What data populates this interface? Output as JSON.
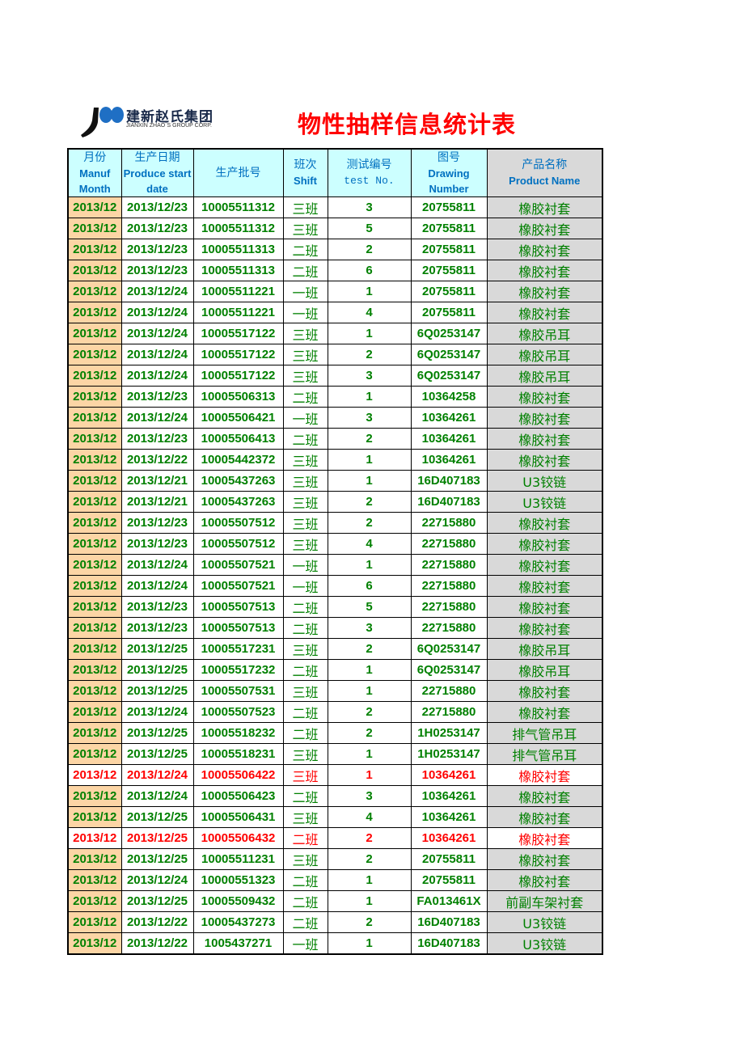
{
  "logo": {
    "name_cn": "建新赵氏集团",
    "name_en": "JIANXIN ZHAO`S GROUP CORP.",
    "icon": "jianxin-logo-mark"
  },
  "title": "物性抽样信息统计表",
  "colors": {
    "header_bg": "#ccffff",
    "header_text": "#0070c0",
    "month_bg": "#fcd5a5",
    "product_bg": "#d9d9d9",
    "normal_text": "#008000",
    "flagged_text": "#ff0000",
    "title": "#ff0000"
  },
  "headers": {
    "month": {
      "cn": "月份",
      "en1": "Manuf",
      "en2": "Month"
    },
    "date": {
      "cn": "生产日期",
      "en1": "Produce start",
      "en2": "date"
    },
    "batch": {
      "cn": "生产批号"
    },
    "shift": {
      "cn": "班次",
      "en1": "Shift"
    },
    "test": {
      "cn": "测试编号",
      "en1": "test No."
    },
    "drawing": {
      "cn": "图号",
      "en1": "Drawing",
      "en2": "Number"
    },
    "product": {
      "cn": "产品名称",
      "en1": "Product Name"
    }
  },
  "rows": [
    {
      "month": "2013/12",
      "date": "2013/12/23",
      "batch": "10005511312",
      "shift": "三班",
      "test": "3",
      "drawing": "20755811",
      "product": "橡胶衬套",
      "flagged": false
    },
    {
      "month": "2013/12",
      "date": "2013/12/23",
      "batch": "10005511312",
      "shift": "三班",
      "test": "5",
      "drawing": "20755811",
      "product": "橡胶衬套",
      "flagged": false
    },
    {
      "month": "2013/12",
      "date": "2013/12/23",
      "batch": "10005511313",
      "shift": "二班",
      "test": "2",
      "drawing": "20755811",
      "product": "橡胶衬套",
      "flagged": false
    },
    {
      "month": "2013/12",
      "date": "2013/12/23",
      "batch": "10005511313",
      "shift": "二班",
      "test": "6",
      "drawing": "20755811",
      "product": "橡胶衬套",
      "flagged": false
    },
    {
      "month": "2013/12",
      "date": "2013/12/24",
      "batch": "10005511221",
      "shift": "一班",
      "test": "1",
      "drawing": "20755811",
      "product": "橡胶衬套",
      "flagged": false
    },
    {
      "month": "2013/12",
      "date": "2013/12/24",
      "batch": "10005511221",
      "shift": "一班",
      "test": "4",
      "drawing": "20755811",
      "product": "橡胶衬套",
      "flagged": false
    },
    {
      "month": "2013/12",
      "date": "2013/12/24",
      "batch": "10005517122",
      "shift": "三班",
      "test": "1",
      "drawing": "6Q0253147",
      "product": "橡胶吊耳",
      "flagged": false
    },
    {
      "month": "2013/12",
      "date": "2013/12/24",
      "batch": "10005517122",
      "shift": "三班",
      "test": "2",
      "drawing": "6Q0253147",
      "product": "橡胶吊耳",
      "flagged": false
    },
    {
      "month": "2013/12",
      "date": "2013/12/24",
      "batch": "10005517122",
      "shift": "三班",
      "test": "3",
      "drawing": "6Q0253147",
      "product": "橡胶吊耳",
      "flagged": false
    },
    {
      "month": "2013/12",
      "date": "2013/12/23",
      "batch": "10005506313",
      "shift": "二班",
      "test": "1",
      "drawing": "10364258",
      "product": "橡胶衬套",
      "flagged": false
    },
    {
      "month": "2013/12",
      "date": "2013/12/24",
      "batch": "10005506421",
      "shift": "一班",
      "test": "3",
      "drawing": "10364261",
      "product": "橡胶衬套",
      "flagged": false
    },
    {
      "month": "2013/12",
      "date": "2013/12/23",
      "batch": "10005506413",
      "shift": "二班",
      "test": "2",
      "drawing": "10364261",
      "product": "橡胶衬套",
      "flagged": false
    },
    {
      "month": "2013/12",
      "date": "2013/12/22",
      "batch": "10005442372",
      "shift": "三班",
      "test": "1",
      "drawing": "10364261",
      "product": "橡胶衬套",
      "flagged": false
    },
    {
      "month": "2013/12",
      "date": "2013/12/21",
      "batch": "10005437263",
      "shift": "三班",
      "test": "1",
      "drawing": "16D407183",
      "product": "U3铰链",
      "flagged": false
    },
    {
      "month": "2013/12",
      "date": "2013/12/21",
      "batch": "10005437263",
      "shift": "三班",
      "test": "2",
      "drawing": "16D407183",
      "product": "U3铰链",
      "flagged": false
    },
    {
      "month": "2013/12",
      "date": "2013/12/23",
      "batch": "10005507512",
      "shift": "三班",
      "test": "2",
      "drawing": "22715880",
      "product": "橡胶衬套",
      "flagged": false
    },
    {
      "month": "2013/12",
      "date": "2013/12/23",
      "batch": "10005507512",
      "shift": "三班",
      "test": "4",
      "drawing": "22715880",
      "product": "橡胶衬套",
      "flagged": false
    },
    {
      "month": "2013/12",
      "date": "2013/12/24",
      "batch": "10005507521",
      "shift": "一班",
      "test": "1",
      "drawing": "22715880",
      "product": "橡胶衬套",
      "flagged": false
    },
    {
      "month": "2013/12",
      "date": "2013/12/24",
      "batch": "10005507521",
      "shift": "一班",
      "test": "6",
      "drawing": "22715880",
      "product": "橡胶衬套",
      "flagged": false
    },
    {
      "month": "2013/12",
      "date": "2013/12/23",
      "batch": "10005507513",
      "shift": "二班",
      "test": "5",
      "drawing": "22715880",
      "product": "橡胶衬套",
      "flagged": false
    },
    {
      "month": "2013/12",
      "date": "2013/12/23",
      "batch": "10005507513",
      "shift": "二班",
      "test": "3",
      "drawing": "22715880",
      "product": "橡胶衬套",
      "flagged": false
    },
    {
      "month": "2013/12",
      "date": "2013/12/25",
      "batch": "10005517231",
      "shift": "三班",
      "test": "2",
      "drawing": "6Q0253147",
      "product": "橡胶吊耳",
      "flagged": false
    },
    {
      "month": "2013/12",
      "date": "2013/12/25",
      "batch": "10005517232",
      "shift": "二班",
      "test": "1",
      "drawing": "6Q0253147",
      "product": "橡胶吊耳",
      "flagged": false
    },
    {
      "month": "2013/12",
      "date": "2013/12/25",
      "batch": "10005507531",
      "shift": "三班",
      "test": "1",
      "drawing": "22715880",
      "product": "橡胶衬套",
      "flagged": false
    },
    {
      "month": "2013/12",
      "date": "2013/12/24",
      "batch": "10005507523",
      "shift": "二班",
      "test": "2",
      "drawing": "22715880",
      "product": "橡胶衬套",
      "flagged": false
    },
    {
      "month": "2013/12",
      "date": "2013/12/25",
      "batch": "10005518232",
      "shift": "二班",
      "test": "2",
      "drawing": "1H0253147",
      "product": "排气管吊耳",
      "flagged": false
    },
    {
      "month": "2013/12",
      "date": "2013/12/25",
      "batch": "10005518231",
      "shift": "三班",
      "test": "1",
      "drawing": "1H0253147",
      "product": "排气管吊耳",
      "flagged": false
    },
    {
      "month": "2013/12",
      "date": "2013/12/24",
      "batch": "10005506422",
      "shift": "三班",
      "test": "1",
      "drawing": "10364261",
      "product": "橡胶衬套",
      "flagged": true
    },
    {
      "month": "2013/12",
      "date": "2013/12/24",
      "batch": "10005506423",
      "shift": "二班",
      "test": "3",
      "drawing": "10364261",
      "product": "橡胶衬套",
      "flagged": false
    },
    {
      "month": "2013/12",
      "date": "2013/12/25",
      "batch": "10005506431",
      "shift": "三班",
      "test": "4",
      "drawing": "10364261",
      "product": "橡胶衬套",
      "flagged": false
    },
    {
      "month": "2013/12",
      "date": "2013/12/25",
      "batch": "10005506432",
      "shift": "二班",
      "test": "2",
      "drawing": "10364261",
      "product": "橡胶衬套",
      "flagged": true
    },
    {
      "month": "2013/12",
      "date": "2013/12/25",
      "batch": "10005511231",
      "shift": "三班",
      "test": "2",
      "drawing": "20755811",
      "product": "橡胶衬套",
      "flagged": false
    },
    {
      "month": "2013/12",
      "date": "2013/12/24",
      "batch": "10000551323",
      "shift": "二班",
      "test": "1",
      "drawing": "20755811",
      "product": "橡胶衬套",
      "flagged": false
    },
    {
      "month": "2013/12",
      "date": "2013/12/25",
      "batch": "10005509432",
      "shift": "二班",
      "test": "1",
      "drawing": "FA013461X",
      "product": "前副车架衬套",
      "flagged": false
    },
    {
      "month": "2013/12",
      "date": "2013/12/22",
      "batch": "10005437273",
      "shift": "二班",
      "test": "2",
      "drawing": "16D407183",
      "product": "U3铰链",
      "flagged": false
    },
    {
      "month": "2013/12",
      "date": "2013/12/22",
      "batch": "1005437271",
      "shift": "一班",
      "test": "1",
      "drawing": "16D407183",
      "product": "U3铰链",
      "flagged": false
    }
  ]
}
